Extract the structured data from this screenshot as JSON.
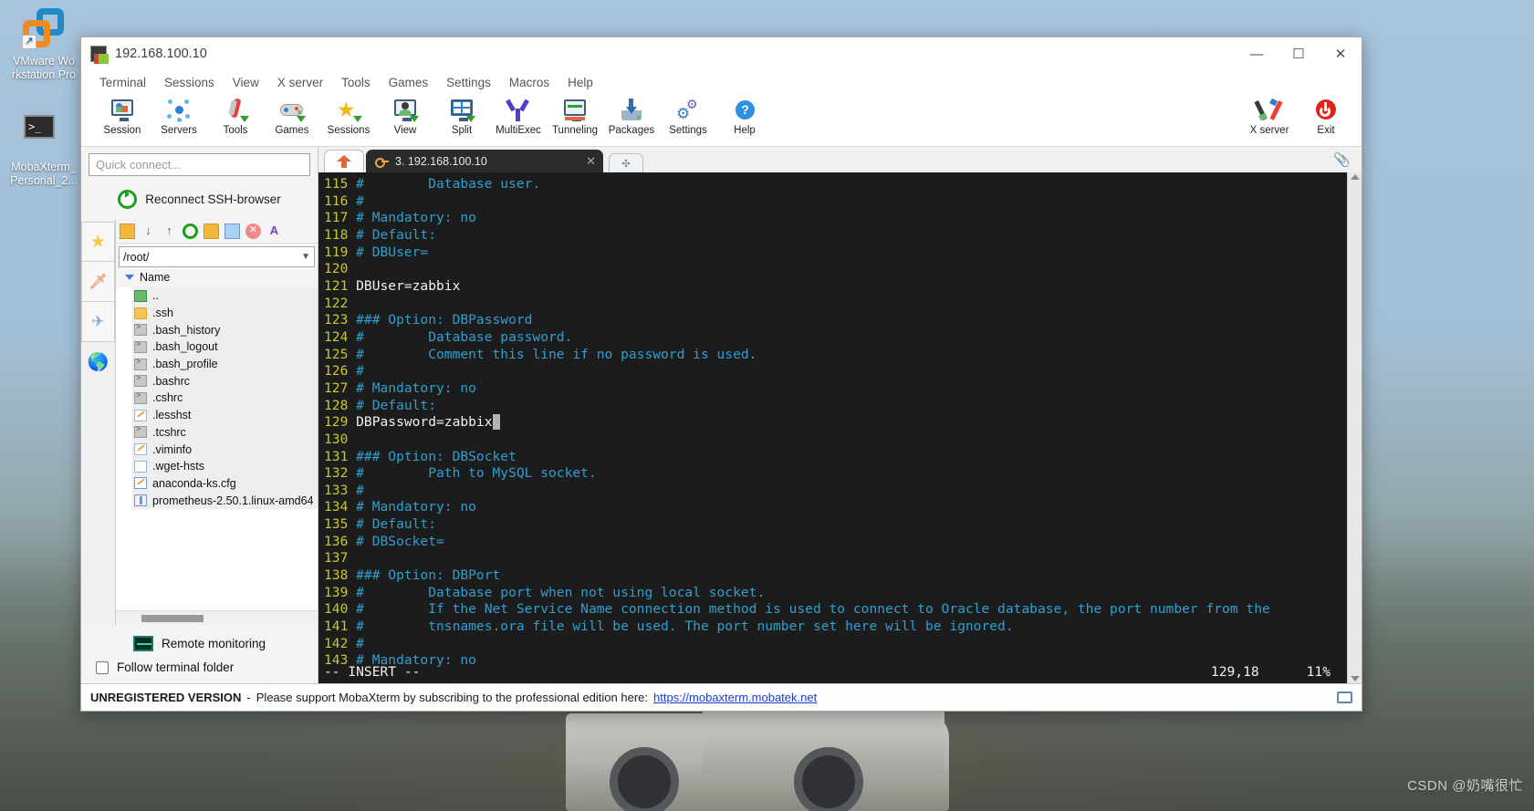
{
  "desktop": {
    "icons": [
      {
        "name": "vmware-workstation-pro",
        "label": "VMware Wo\nrkstation Pro"
      },
      {
        "name": "mobaxterm-personal",
        "label": "MobaXterm_\nPersonal_2..."
      }
    ],
    "watermark": "CSDN @奶嘴很忙"
  },
  "window": {
    "title": "192.168.100.10",
    "controls": {
      "minimize": "—",
      "maximize": "☐",
      "close": "✕"
    }
  },
  "menubar": {
    "items": [
      "Terminal",
      "Sessions",
      "View",
      "X server",
      "Tools",
      "Games",
      "Settings",
      "Macros",
      "Help"
    ]
  },
  "ribbon": {
    "items": [
      {
        "label": "Session",
        "icon": "session-icon"
      },
      {
        "label": "Servers",
        "icon": "servers-icon"
      },
      {
        "label": "Tools",
        "icon": "tools-icon"
      },
      {
        "label": "Games",
        "icon": "games-icon"
      },
      {
        "label": "Sessions",
        "icon": "sessions-star-icon"
      },
      {
        "label": "View",
        "icon": "view-icon"
      },
      {
        "label": "Split",
        "icon": "split-icon"
      },
      {
        "label": "MultiExec",
        "icon": "multiexec-icon"
      },
      {
        "label": "Tunneling",
        "icon": "tunneling-icon"
      },
      {
        "label": "Packages",
        "icon": "packages-icon"
      },
      {
        "label": "Settings",
        "icon": "settings-gear-icon"
      },
      {
        "label": "Help",
        "icon": "help-question-icon"
      }
    ],
    "right_items": [
      {
        "label": "X server",
        "icon": "x-server-icon"
      },
      {
        "label": "Exit",
        "icon": "power-exit-icon"
      }
    ]
  },
  "sidebar": {
    "quick_connect_placeholder": "Quick connect...",
    "reconnect_label": "Reconnect SSH-browser",
    "vertical_tabs": [
      "star-icon",
      "swiss-knife-icon",
      "paper-plane-icon",
      "globe-icon"
    ],
    "fb_toolbar_icons": [
      "go-up-icon",
      "download-icon",
      "upload-icon",
      "refresh-icon",
      "new-folder-icon",
      "new-file-icon",
      "delete-icon",
      "text-mode-icon"
    ],
    "path": "/root/",
    "column_header": "Name",
    "files": [
      {
        "name": "..",
        "icon": "parent-folder-icon"
      },
      {
        "name": ".ssh",
        "icon": "folder-icon"
      },
      {
        "name": ".bash_history",
        "icon": "shell-file-icon"
      },
      {
        "name": ".bash_logout",
        "icon": "shell-file-icon"
      },
      {
        "name": ".bash_profile",
        "icon": "shell-file-icon"
      },
      {
        "name": ".bashrc",
        "icon": "shell-file-icon"
      },
      {
        "name": ".cshrc",
        "icon": "shell-file-icon"
      },
      {
        "name": ".lesshst",
        "icon": "text-file-icon"
      },
      {
        "name": ".tcshrc",
        "icon": "shell-file-icon"
      },
      {
        "name": ".viminfo",
        "icon": "text-file-icon"
      },
      {
        "name": ".wget-hsts",
        "icon": "plain-file-icon"
      },
      {
        "name": "anaconda-ks.cfg",
        "icon": "config-file-icon"
      },
      {
        "name": "prometheus-2.50.1.linux-amd64",
        "icon": "archive-file-icon"
      }
    ],
    "remote_monitoring_label": "Remote monitoring",
    "follow_terminal_folder_label": "Follow terminal folder",
    "follow_terminal_folder_checked": false
  },
  "tabs": {
    "home_tab": "home-icon",
    "active_tab_label": "3. 192.168.100.10",
    "close_glyph": "✕",
    "new_tab_glyph": "✣"
  },
  "terminal": {
    "lines": [
      {
        "no": "115",
        "text": "#        Database user.",
        "kind": "comment"
      },
      {
        "no": "116",
        "text": "#",
        "kind": "comment"
      },
      {
        "no": "117",
        "text": "# Mandatory: no",
        "kind": "comment"
      },
      {
        "no": "118",
        "text": "# Default:",
        "kind": "comment"
      },
      {
        "no": "119",
        "text": "# DBUser=",
        "kind": "comment"
      },
      {
        "no": "120",
        "text": "",
        "kind": "comment"
      },
      {
        "no": "121",
        "text": "DBUser=zabbix",
        "kind": "plain"
      },
      {
        "no": "122",
        "text": "",
        "kind": "comment"
      },
      {
        "no": "123",
        "text": "### Option: DBPassword",
        "kind": "comment"
      },
      {
        "no": "124",
        "text": "#        Database password.",
        "kind": "comment"
      },
      {
        "no": "125",
        "text": "#        Comment this line if no password is used.",
        "kind": "comment"
      },
      {
        "no": "126",
        "text": "#",
        "kind": "comment"
      },
      {
        "no": "127",
        "text": "# Mandatory: no",
        "kind": "comment"
      },
      {
        "no": "128",
        "text": "# Default:",
        "kind": "comment"
      },
      {
        "no": "129",
        "text": "DBPassword=zabbix",
        "kind": "cursor"
      },
      {
        "no": "130",
        "text": "",
        "kind": "comment"
      },
      {
        "no": "131",
        "text": "### Option: DBSocket",
        "kind": "comment"
      },
      {
        "no": "132",
        "text": "#        Path to MySQL socket.",
        "kind": "comment"
      },
      {
        "no": "133",
        "text": "#",
        "kind": "comment"
      },
      {
        "no": "134",
        "text": "# Mandatory: no",
        "kind": "comment"
      },
      {
        "no": "135",
        "text": "# Default:",
        "kind": "comment"
      },
      {
        "no": "136",
        "text": "# DBSocket=",
        "kind": "comment"
      },
      {
        "no": "137",
        "text": "",
        "kind": "comment"
      },
      {
        "no": "138",
        "text": "### Option: DBPort",
        "kind": "comment"
      },
      {
        "no": "139",
        "text": "#        Database port when not using local socket.",
        "kind": "comment"
      },
      {
        "no": "140",
        "text": "#        If the Net Service Name connection method is used to connect to Oracle database, the port number from the",
        "kind": "comment"
      },
      {
        "no": "141",
        "text": "#        tnsnames.ora file will be used. The port number set here will be ignored.",
        "kind": "comment"
      },
      {
        "no": "142",
        "text": "#",
        "kind": "comment"
      },
      {
        "no": "143",
        "text": "# Mandatory: no",
        "kind": "comment"
      }
    ],
    "status_mode": "-- INSERT --",
    "status_position": "129,18",
    "status_percent": "11%"
  },
  "app_status": {
    "unregistered": "UNREGISTERED VERSION",
    "separator": "-",
    "message": "Please support MobaXterm by subscribing to the professional edition here:",
    "link": "https://mobaxterm.mobatek.net"
  },
  "colors": {
    "terminal_bg": "#1c1c1c",
    "line_number": "#c8c832",
    "comment": "#2f9fd0",
    "plain_text": "#f2f2f2",
    "accent_blue": "#1a3fd0"
  }
}
